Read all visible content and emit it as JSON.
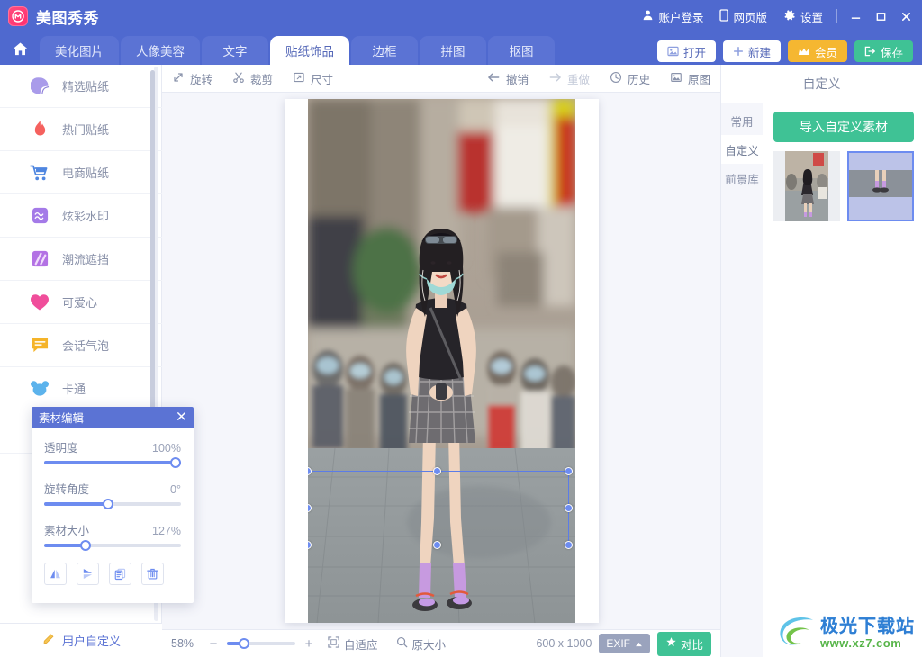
{
  "app": {
    "brand_name": "美图秀秀",
    "logo_icon": "meitu-logo-icon"
  },
  "topbar": {
    "account_label": "账户登录",
    "account_icon": "user-icon",
    "web_label": "网页版",
    "web_icon": "phone-icon",
    "settings_label": "设置",
    "settings_icon": "gear-icon",
    "minimize_icon": "minimize-icon",
    "maximize_icon": "maximize-icon",
    "close_icon": "close-icon"
  },
  "tabs": {
    "home_icon": "home-icon",
    "items": [
      {
        "label": "美化图片",
        "active": false
      },
      {
        "label": "人像美容",
        "active": false
      },
      {
        "label": "文字",
        "active": false
      },
      {
        "label": "贴纸饰品",
        "active": true
      },
      {
        "label": "边框",
        "active": false
      },
      {
        "label": "拼图",
        "active": false
      },
      {
        "label": "抠图",
        "active": false
      }
    ],
    "actions": [
      {
        "label": "打开",
        "icon": "image-open-icon",
        "style": "white"
      },
      {
        "label": "新建",
        "icon": "plus-icon",
        "style": "white"
      },
      {
        "label": "会员",
        "icon": "crown-icon",
        "style": "gold"
      },
      {
        "label": "保存",
        "icon": "save-export-icon",
        "style": "green"
      }
    ]
  },
  "sidebar": {
    "items": [
      {
        "label": "精选贴纸",
        "icon": "sticker-badge-icon",
        "color": "#9b8fe0"
      },
      {
        "label": "热门贴纸",
        "icon": "flame-icon",
        "color": "#f56464"
      },
      {
        "label": "电商贴纸",
        "icon": "shopping-cart-icon",
        "color": "#5b8ee8"
      },
      {
        "label": "炫彩水印",
        "icon": "watermark-icon",
        "color": "#a07ae8"
      },
      {
        "label": "潮流遮挡",
        "icon": "stripes-icon",
        "color": "#b06ae0"
      },
      {
        "label": "可爱心",
        "icon": "heart-icon",
        "color": "#f0509b"
      },
      {
        "label": "会话气泡",
        "icon": "speech-bubble-icon",
        "color": "#f0b429"
      },
      {
        "label": "卡通",
        "icon": "cartoon-bear-icon",
        "color": "#5cb3ec"
      }
    ],
    "bottom_label": "用户自定义",
    "bottom_icon": "pencil-icon"
  },
  "toolbar": {
    "items": [
      {
        "label": "旋转",
        "icon": "rotate-icon",
        "disabled": false
      },
      {
        "label": "裁剪",
        "icon": "scissors-icon",
        "disabled": false
      },
      {
        "label": "尺寸",
        "icon": "resize-icon",
        "disabled": false
      }
    ],
    "history_items": [
      {
        "label": "撤销",
        "icon": "undo-arrow-icon",
        "disabled": false
      },
      {
        "label": "重做",
        "icon": "redo-arrow-icon",
        "disabled": true
      },
      {
        "label": "历史",
        "icon": "clock-icon",
        "disabled": false
      },
      {
        "label": "原图",
        "icon": "original-image-icon",
        "disabled": false
      }
    ]
  },
  "statusbar": {
    "zoom_level": "58%",
    "zoom_out_icon": "minus-icon",
    "zoom_in_icon": "plus-icon",
    "fit_label": "自适应",
    "fit_icon": "fit-screen-icon",
    "actual_label": "原大小",
    "actual_icon": "magnifier-icon",
    "dimensions": "600 x 1000",
    "exif_label": "EXIF",
    "exif_caret_icon": "caret-up-icon",
    "compare_label": "对比",
    "compare_icon": "star-compare-icon"
  },
  "right_panel": {
    "title": "自定义",
    "tabs": [
      {
        "label": "常用",
        "active": false
      },
      {
        "label": "自定义",
        "active": true
      },
      {
        "label": "前景库",
        "active": false
      }
    ],
    "import_button": "导入自定义素材",
    "thumbnails": [
      {
        "name": "full-photo-thumbnail",
        "selected": false
      },
      {
        "name": "legs-crop-thumbnail",
        "selected": true
      }
    ]
  },
  "material_panel": {
    "title": "素材编辑",
    "close_icon": "close-icon",
    "sliders": [
      {
        "label": "透明度",
        "value": "100%",
        "percent": 100
      },
      {
        "label": "旋转角度",
        "value": "0°",
        "percent": 45
      },
      {
        "label": "素材大小",
        "value": "127%",
        "percent": 28
      }
    ],
    "buttons": [
      {
        "name": "flip-horizontal-button",
        "icon": "flip-horizontal-icon"
      },
      {
        "name": "flip-vertical-button",
        "icon": "flip-vertical-icon"
      },
      {
        "name": "duplicate-button",
        "icon": "copy-icon"
      },
      {
        "name": "delete-button",
        "icon": "trash-icon"
      }
    ]
  },
  "watermark": {
    "title": "极光下载站",
    "url": "www.xz7.com",
    "logo_icon": "aurora-swirl-icon"
  },
  "colors": {
    "brand_blue": "#4f69cf",
    "tab_active_bg": "#ffffff",
    "accent_green": "#3fc295",
    "accent_gold": "#f5b731",
    "slider_blue": "#6d8cf0",
    "selection_blue": "#5b7ce8"
  }
}
